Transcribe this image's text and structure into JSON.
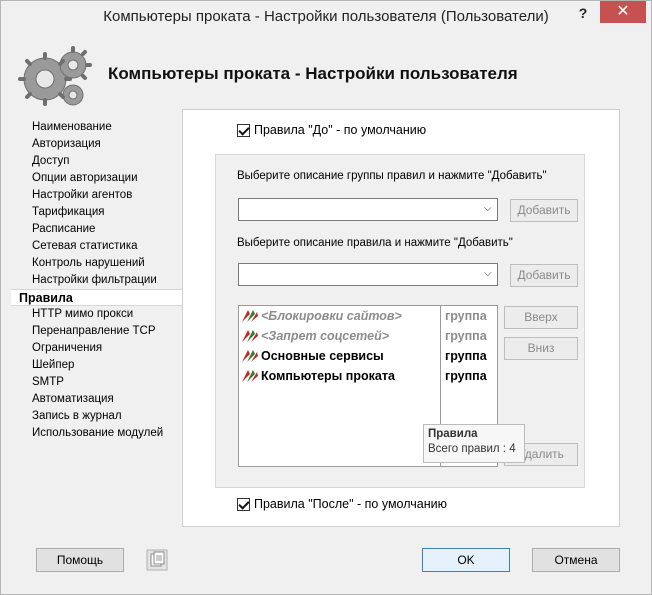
{
  "window": {
    "title": "Компьютеры проката - Настройки пользователя (Пользователи)",
    "help_label": "?",
    "close_label": "✕"
  },
  "header": {
    "title": "Компьютеры проката - Настройки пользователя",
    "logo_icon": "gears-icon"
  },
  "sidebar": {
    "items": [
      {
        "label": "Наименование"
      },
      {
        "label": "Авторизация"
      },
      {
        "label": "Доступ"
      },
      {
        "label": "Опции авторизации"
      },
      {
        "label": "Настройки агентов"
      },
      {
        "label": "Тарификация"
      },
      {
        "label": "Расписание"
      },
      {
        "label": "Сетевая статистика"
      },
      {
        "label": "Контроль нарушений"
      },
      {
        "label": "Настройки фильтрации"
      },
      {
        "label": "Правила",
        "active": true
      },
      {
        "label": "HTTP мимо прокси"
      },
      {
        "label": "Перенаправление TCP"
      },
      {
        "label": "Ограничения"
      },
      {
        "label": "Шейпер"
      },
      {
        "label": "SMTP"
      },
      {
        "label": "Автоматизация"
      },
      {
        "label": "Запись в журнал"
      },
      {
        "label": "Использование модулей"
      }
    ]
  },
  "rules_page": {
    "before_default": {
      "label": "Правила \"До\" - по умолчанию",
      "checked": true
    },
    "after_default": {
      "label": "Правила \"После\" - по умолчанию",
      "checked": true
    },
    "group_prompt": "Выберите описание группы правил и нажмите \"Добавить\"",
    "group_select_value": "",
    "group_add_label": "Добавить",
    "rule_prompt": "Выберите описание правила и нажмите \"Добавить\"",
    "rule_select_value": "",
    "rule_add_label": "Добавить",
    "rules": [
      {
        "name": "<Блокировки сайтов>",
        "type": "группа",
        "disabled": true
      },
      {
        "name": "<Запрет соцсетей>",
        "type": "группа",
        "disabled": true
      },
      {
        "name": "Основные сервисы",
        "type": "группа",
        "disabled": false
      },
      {
        "name": "Компьютеры проката",
        "type": "группа",
        "disabled": false
      }
    ],
    "up_label": "Вверх",
    "down_label": "Вниз",
    "delete_label": "Удалить",
    "tooltip": {
      "title": "Правила",
      "body": "Всего правил : 4"
    }
  },
  "footer": {
    "help_label": "Помощь",
    "ok_label": "OK",
    "cancel_label": "Отмена",
    "notes_icon": "clipboard-icon"
  },
  "colors": {
    "close_button": "#c75050",
    "ok_border": "#3c7fb1",
    "disabled_text": "#8c8c8c"
  }
}
